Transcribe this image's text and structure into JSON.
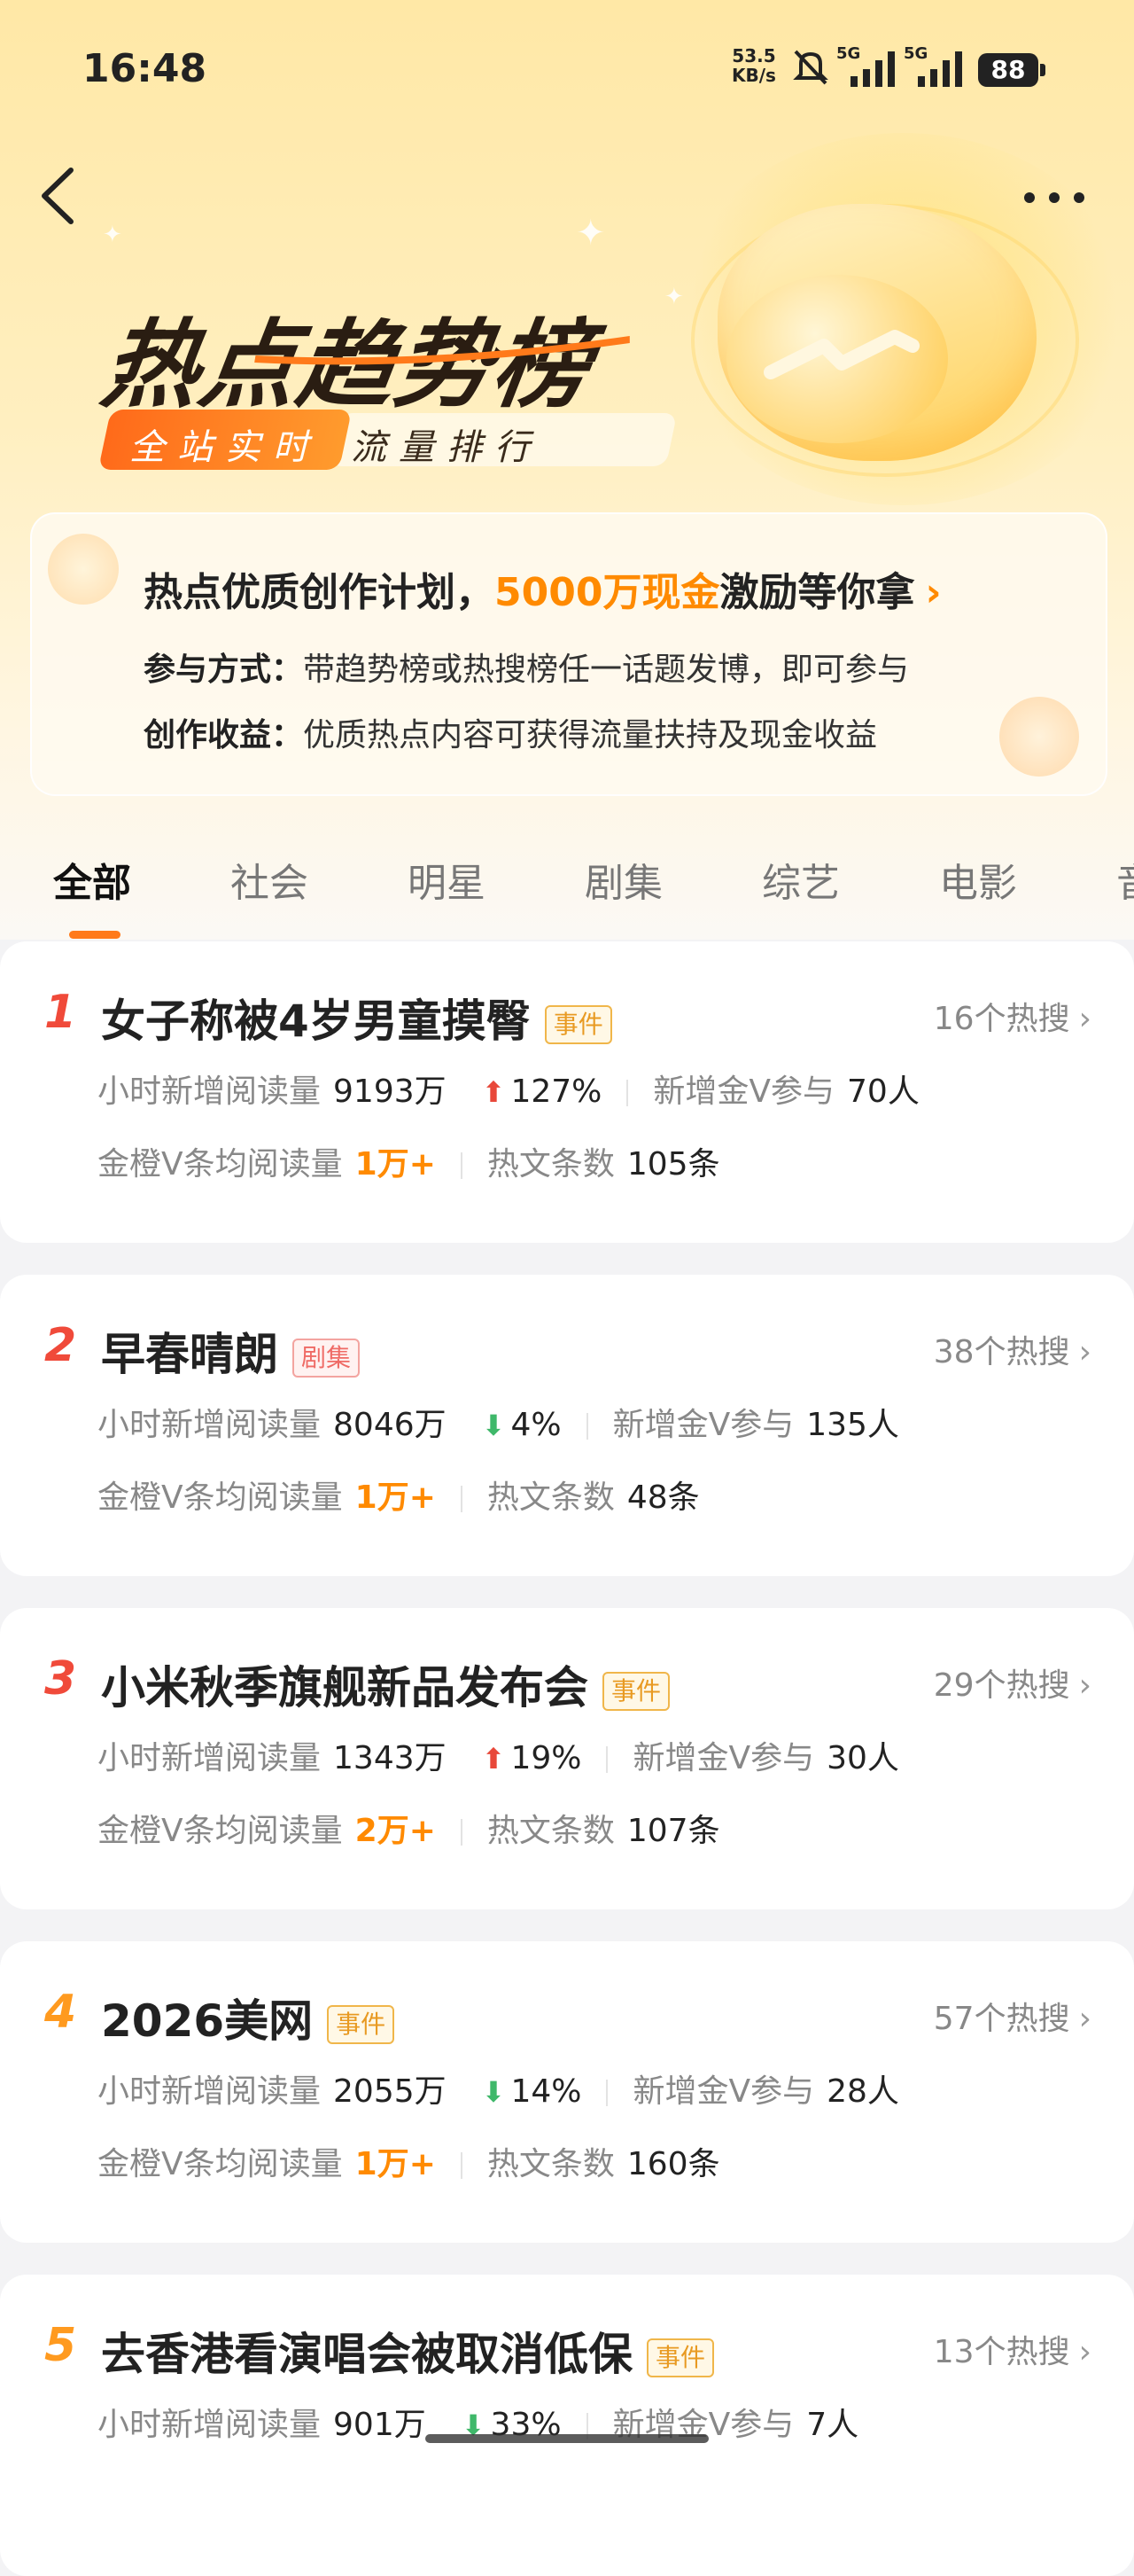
{
  "status_bar": {
    "time": "16:48",
    "net_speed_value": "53.5",
    "net_speed_unit": "KB/s",
    "signal1_label": "5G",
    "signal2_label": "5G",
    "battery": "88"
  },
  "header": {
    "title": "热点趋势榜",
    "tag_primary": "全站实时",
    "tag_secondary": "流量排行"
  },
  "promo": {
    "title_pre": "热点优质创作计划，",
    "title_highlight": "5000万现金",
    "title_post": "激励等你拿",
    "line1_label": "参与方式：",
    "line1_text": "带趋势榜或热搜榜任一话题发博，即可参与",
    "line2_label": "创作收益：",
    "line2_text": "优质热点内容可获得流量扶持及现金收益"
  },
  "tabs": [
    "全部",
    "社会",
    "明星",
    "剧集",
    "综艺",
    "电影",
    "音"
  ],
  "active_tab": "全部",
  "labels": {
    "hourly_reads": "小时新增阅读量",
    "new_v": "新增金V参与",
    "avg_reads": "金橙V条均阅读量",
    "hot_posts": "热文条数"
  },
  "items": [
    {
      "rank": "1",
      "title": "女子称被4岁男童摸臀",
      "badge": "事件",
      "hot_searches": "16个热搜",
      "hourly_reads": "9193万",
      "trend": "up",
      "trend_pct": "127%",
      "new_v": "70人",
      "avg_reads": "1万+",
      "hot_posts": "105条"
    },
    {
      "rank": "2",
      "title": "早春晴朗",
      "badge": "剧集",
      "hot_searches": "38个热搜",
      "hourly_reads": "8046万",
      "trend": "down",
      "trend_pct": "4%",
      "new_v": "135人",
      "avg_reads": "1万+",
      "hot_posts": "48条"
    },
    {
      "rank": "3",
      "title": "小米秋季旗舰新品发布会",
      "badge": "事件",
      "hot_searches": "29个热搜",
      "hourly_reads": "1343万",
      "trend": "up",
      "trend_pct": "19%",
      "new_v": "30人",
      "avg_reads": "2万+",
      "hot_posts": "107条"
    },
    {
      "rank": "4",
      "title": "2026美网",
      "badge": "事件",
      "hot_searches": "57个热搜",
      "hourly_reads": "2055万",
      "trend": "down",
      "trend_pct": "14%",
      "new_v": "28人",
      "avg_reads": "1万+",
      "hot_posts": "160条"
    },
    {
      "rank": "5",
      "title": "去香港看演唱会被取消低保",
      "badge": "事件",
      "hot_searches": "13个热搜",
      "hourly_reads": "901万",
      "trend": "down",
      "trend_pct": "33%",
      "new_v": "7人",
      "avg_reads": "",
      "hot_posts": ""
    }
  ],
  "colors": {
    "accent": "#ff7a1a",
    "highlight": "#ff8a00",
    "rank_red": "#f04a3a",
    "rank_orange": "#ff9a1f",
    "trend_up": "#e8483a",
    "trend_down": "#3fb86a"
  },
  "icons": {
    "back": "back-arrow-icon",
    "more": "more-dots-icon",
    "chevron": "chevron-right-icon"
  }
}
